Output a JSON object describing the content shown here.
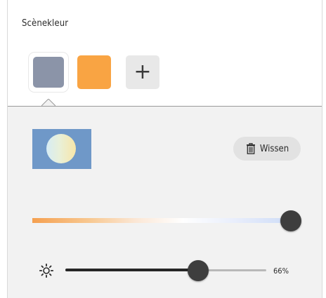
{
  "title": "Scènekleur",
  "swatches": [
    {
      "color": "#8b94a8",
      "selected": true
    },
    {
      "color": "#f9a443",
      "selected": false
    }
  ],
  "add_swatch": {
    "label": "+",
    "icon": "plus-icon"
  },
  "preview": {
    "background": "#6f98c8"
  },
  "clear_button": {
    "label": "Wissen",
    "icon": "trash-icon"
  },
  "color_temperature": {
    "value": 1.0
  },
  "brightness": {
    "value": 0.66,
    "label": "66%",
    "icon": "sun-icon"
  }
}
